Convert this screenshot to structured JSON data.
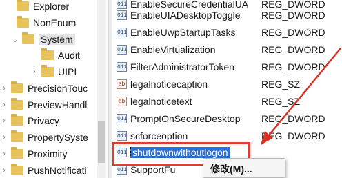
{
  "tree": {
    "items": [
      {
        "label": "Explorer",
        "expander": "",
        "selected": false
      },
      {
        "label": "NonEnum",
        "expander": "",
        "selected": false
      },
      {
        "label": "System",
        "expander": "⌄",
        "selected": true
      },
      {
        "label": "Audit",
        "expander": "",
        "selected": false
      },
      {
        "label": "UIPI",
        "expander": "›",
        "selected": false
      },
      {
        "label": "PrecisionTouc",
        "expander": "›",
        "selected": false
      },
      {
        "label": "PreviewHandl",
        "expander": "›",
        "selected": false
      },
      {
        "label": "Privacy",
        "expander": "›",
        "selected": false
      },
      {
        "label": "PropertySyste",
        "expander": "›",
        "selected": false
      },
      {
        "label": "Proximity",
        "expander": "›",
        "selected": false
      },
      {
        "label": "PushNotificati",
        "expander": "›",
        "selected": false
      }
    ]
  },
  "values": {
    "rows": [
      {
        "name": "EnableSecureCredentialUA",
        "type": "REG_DWORD",
        "icon": "dword-value-icon"
      },
      {
        "name": "EnableUIADesktopToggle",
        "type": "REG_DWORD",
        "icon": "dword-value-icon"
      },
      {
        "name": "EnableUwpStartupTasks",
        "type": "REG_DWORD",
        "icon": "dword-value-icon"
      },
      {
        "name": "EnableVirtualization",
        "type": "REG_DWORD",
        "icon": "dword-value-icon"
      },
      {
        "name": "FilterAdministratorToken",
        "type": "REG_DWORD",
        "icon": "dword-value-icon"
      },
      {
        "name": "legalnoticecaption",
        "type": "REG_SZ",
        "icon": "string-value-icon"
      },
      {
        "name": "legalnoticetext",
        "type": "REG_SZ",
        "icon": "string-value-icon"
      },
      {
        "name": "PromptOnSecureDesktop",
        "type": "REG_DWORD",
        "icon": "dword-value-icon"
      },
      {
        "name": "scforceoption",
        "type": "REG_DWORD",
        "icon": "dword-value-icon"
      },
      {
        "name": "shutdownwithoutlogon",
        "type": "",
        "icon": "dword-value-icon"
      },
      {
        "name": "SupportFu",
        "type": "",
        "icon": "dword-value-icon"
      }
    ]
  },
  "context_menu": {
    "modify_label": "修改(M)..."
  },
  "colors": {
    "highlight_box": "#e43b2c",
    "selection_blue": "#2f6fcf",
    "folder_yellow": "#e8c35a"
  }
}
